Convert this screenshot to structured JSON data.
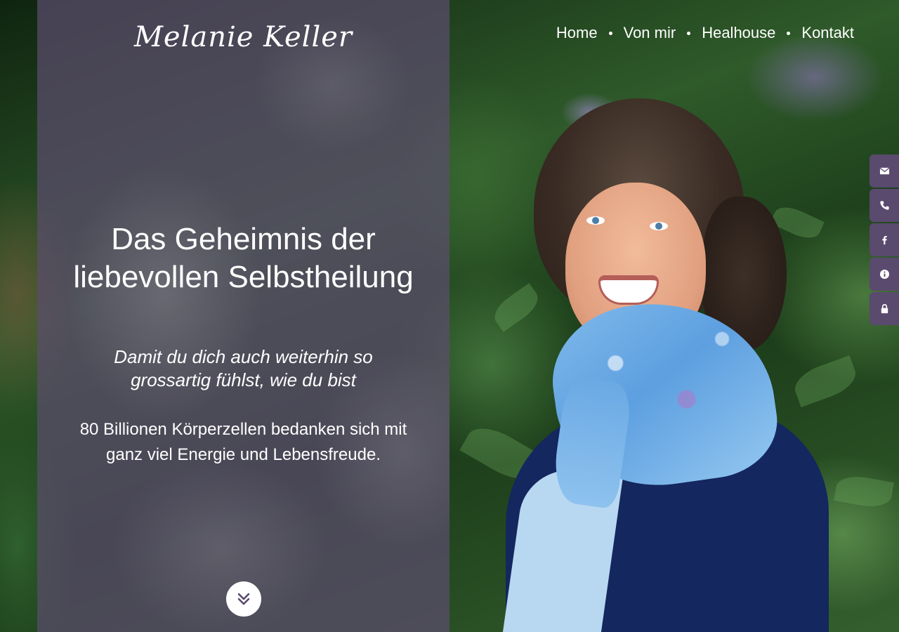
{
  "site": {
    "logo_text": "Melanie Keller"
  },
  "nav": {
    "items": [
      {
        "label": "Home"
      },
      {
        "label": "Von mir"
      },
      {
        "label": "Healhouse"
      },
      {
        "label": "Kontakt"
      }
    ]
  },
  "hero": {
    "headline_line1": "Das Geheimnis der",
    "headline_line2": "liebevollen Selbstheilung",
    "subline_line1": "Damit du dich auch weiterhin so",
    "subline_line2": "grossartig fühlst, wie du bist",
    "body_line1": "80 Billionen Körperzellen bedanken sich mit",
    "body_line2": "ganz viel Energie und Lebensfreude."
  },
  "side_tabs": [
    {
      "icon": "envelope-icon"
    },
    {
      "icon": "phone-icon"
    },
    {
      "icon": "facebook-icon"
    },
    {
      "icon": "info-icon"
    },
    {
      "icon": "lock-icon"
    }
  ],
  "scroll_button": {
    "icon": "double-chevron-down-icon"
  },
  "colors": {
    "panel_overlay": "#5c4c6e",
    "side_tab_bg": "#5a4a6e",
    "text": "#ffffff"
  }
}
